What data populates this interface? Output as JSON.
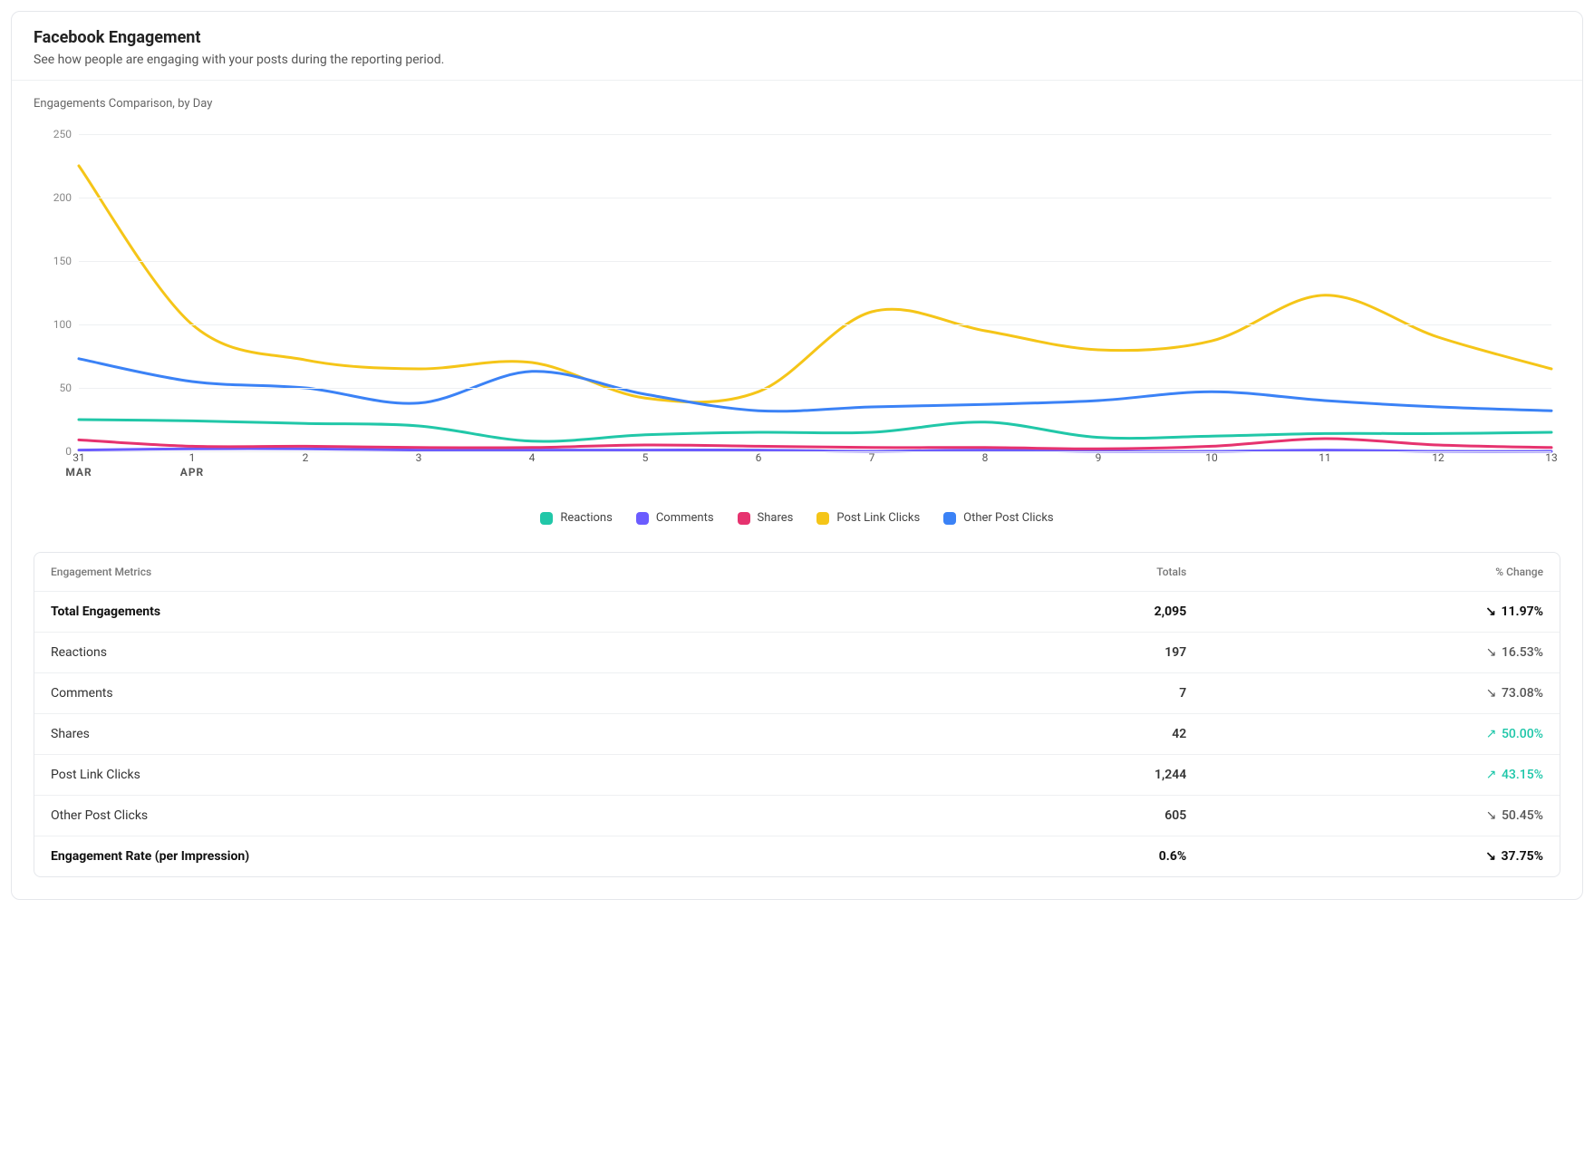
{
  "header": {
    "title": "Facebook Engagement",
    "subtitle": "See how people are engaging with your posts during the reporting period."
  },
  "chart": {
    "title": "Engagements Comparison, by Day"
  },
  "chart_data": {
    "type": "line",
    "title": "Engagements Comparison, by Day",
    "xlabel": "",
    "ylabel": "",
    "ylim": [
      0,
      250
    ],
    "y_ticks": [
      0,
      50,
      100,
      150,
      200,
      250
    ],
    "x_ticks": [
      {
        "label": "31",
        "month": "MAR"
      },
      {
        "label": "1",
        "month": "APR"
      },
      {
        "label": "2"
      },
      {
        "label": "3"
      },
      {
        "label": "4"
      },
      {
        "label": "5"
      },
      {
        "label": "6"
      },
      {
        "label": "7"
      },
      {
        "label": "8"
      },
      {
        "label": "9"
      },
      {
        "label": "10"
      },
      {
        "label": "11"
      },
      {
        "label": "12"
      },
      {
        "label": "13"
      }
    ],
    "legend": [
      {
        "name": "Reactions",
        "color": "#21c7a8"
      },
      {
        "name": "Comments",
        "color": "#6b5cff"
      },
      {
        "name": "Shares",
        "color": "#e6336f"
      },
      {
        "name": "Post Link Clicks",
        "color": "#f5c518"
      },
      {
        "name": "Other Post Clicks",
        "color": "#3b82f6"
      }
    ],
    "series": [
      {
        "name": "Reactions",
        "color": "#21c7a8",
        "values": [
          25,
          24,
          22,
          20,
          8,
          13,
          15,
          15,
          23,
          11,
          12,
          14,
          14,
          15
        ]
      },
      {
        "name": "Comments",
        "color": "#6b5cff",
        "values": [
          1,
          2,
          2,
          1,
          1,
          1,
          1,
          0,
          1,
          0,
          0,
          1,
          0,
          0
        ]
      },
      {
        "name": "Shares",
        "color": "#e6336f",
        "values": [
          9,
          4,
          4,
          3,
          3,
          5,
          4,
          3,
          3,
          2,
          4,
          10,
          5,
          3
        ]
      },
      {
        "name": "Post Link Clicks",
        "color": "#f5c518",
        "values": [
          225,
          100,
          72,
          65,
          70,
          42,
          47,
          110,
          95,
          80,
          87,
          123,
          90,
          65
        ]
      },
      {
        "name": "Other Post Clicks",
        "color": "#3b82f6",
        "values": [
          73,
          55,
          50,
          38,
          63,
          45,
          32,
          35,
          37,
          40,
          47,
          40,
          35,
          32
        ]
      }
    ]
  },
  "table": {
    "headers": {
      "metric": "Engagement Metrics",
      "totals": "Totals",
      "change": "% Change"
    },
    "rows": [
      {
        "label": "Total Engagements",
        "value": "2,095",
        "change": "11.97%",
        "direction": "down",
        "bold": true
      },
      {
        "label": "Reactions",
        "value": "197",
        "change": "16.53%",
        "direction": "down",
        "bold": false
      },
      {
        "label": "Comments",
        "value": "7",
        "change": "73.08%",
        "direction": "down",
        "bold": false
      },
      {
        "label": "Shares",
        "value": "42",
        "change": "50.00%",
        "direction": "up",
        "bold": false
      },
      {
        "label": "Post Link Clicks",
        "value": "1,244",
        "change": "43.15%",
        "direction": "up",
        "bold": false
      },
      {
        "label": "Other Post Clicks",
        "value": "605",
        "change": "50.45%",
        "direction": "down",
        "bold": false
      },
      {
        "label": "Engagement Rate (per Impression)",
        "value": "0.6%",
        "change": "37.75%",
        "direction": "down",
        "bold": true
      }
    ]
  }
}
